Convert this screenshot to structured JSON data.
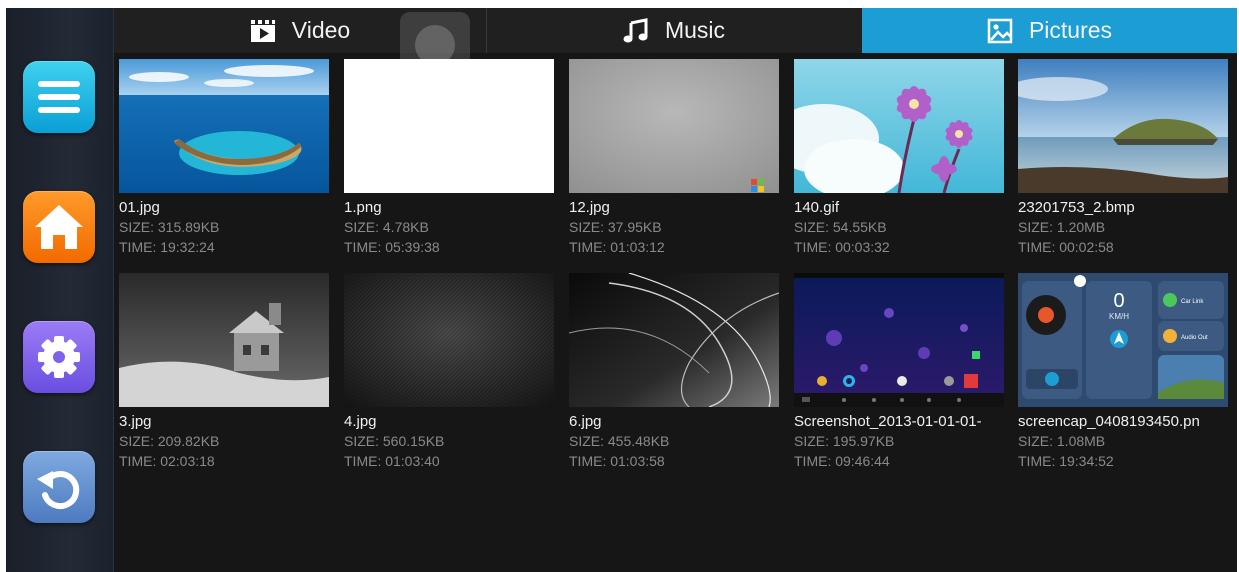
{
  "sidebar": {
    "buttons": [
      {
        "name": "menu",
        "icon": "menu-icon"
      },
      {
        "name": "home",
        "icon": "home-icon"
      },
      {
        "name": "settings",
        "icon": "gear-icon"
      },
      {
        "name": "back",
        "icon": "back-arrow-icon"
      }
    ]
  },
  "tabs": {
    "video": {
      "label": "Video",
      "icon": "video-clapper-icon"
    },
    "music": {
      "label": "Music",
      "icon": "music-note-icon"
    },
    "pictures": {
      "label": "Pictures",
      "icon": "picture-icon",
      "active": true,
      "active_color": "#1c9ed5"
    }
  },
  "files": [
    {
      "name": "01.jpg",
      "size": "SIZE: 315.89KB",
      "time": "TIME: 19:32:24"
    },
    {
      "name": "1.png",
      "size": "SIZE: 4.78KB",
      "time": "TIME: 05:39:38"
    },
    {
      "name": "12.jpg",
      "size": "SIZE: 37.95KB",
      "time": "TIME: 01:03:12"
    },
    {
      "name": "140.gif",
      "size": "SIZE: 54.55KB",
      "time": "TIME: 00:03:32"
    },
    {
      "name": "23201753_2.bmp",
      "size": "SIZE: 1.20MB",
      "time": "TIME: 00:02:58"
    },
    {
      "name": "3.jpg",
      "size": "SIZE: 209.82KB",
      "time": "TIME: 02:03:18"
    },
    {
      "name": "4.jpg",
      "size": "SIZE: 560.15KB",
      "time": "TIME: 01:03:40"
    },
    {
      "name": "6.jpg",
      "size": "SIZE: 455.48KB",
      "time": "TIME: 01:03:58"
    },
    {
      "name": "Screenshot_2013-01-01-01-",
      "size": "SIZE: 195.97KB",
      "time": "TIME: 09:46:44"
    },
    {
      "name": "screencap_0408193450.pn",
      "size": "SIZE: 1.08MB",
      "time": "TIME: 19:34:52"
    }
  ],
  "thumb_text": {
    "speed_value": "0",
    "speed_unit": "KM/H",
    "car_link": "Car Link",
    "audio_out": "Audio Out"
  }
}
